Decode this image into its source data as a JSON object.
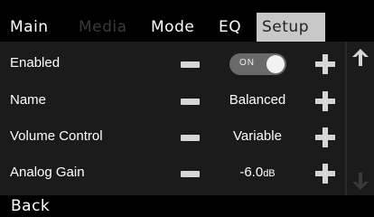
{
  "tabs": [
    {
      "label": "Main",
      "state": "normal"
    },
    {
      "label": "Media",
      "state": "disabled"
    },
    {
      "label": "Mode",
      "state": "normal"
    },
    {
      "label": "EQ",
      "state": "normal"
    },
    {
      "label": "Setup",
      "state": "active"
    }
  ],
  "settings": [
    {
      "label": "Enabled",
      "value": "ON",
      "type": "toggle",
      "toggle_on": true
    },
    {
      "label": "Name",
      "value": "Balanced",
      "type": "text"
    },
    {
      "label": "Volume Control",
      "value": "Variable",
      "type": "text"
    },
    {
      "label": "Analog Gain",
      "value": "-6.0",
      "unit": "dB",
      "type": "text"
    }
  ],
  "scroll": {
    "up_icon": "arrow-up-icon",
    "down_icon": "arrow-down-icon"
  },
  "footer": {
    "back_label": "Back"
  },
  "colors": {
    "panel_bg": "#1b1b1b",
    "active_tab_bg": "#c8c8c8",
    "disabled_tab_text": "#3a3a3a",
    "control_gray": "#d6d6d6"
  }
}
